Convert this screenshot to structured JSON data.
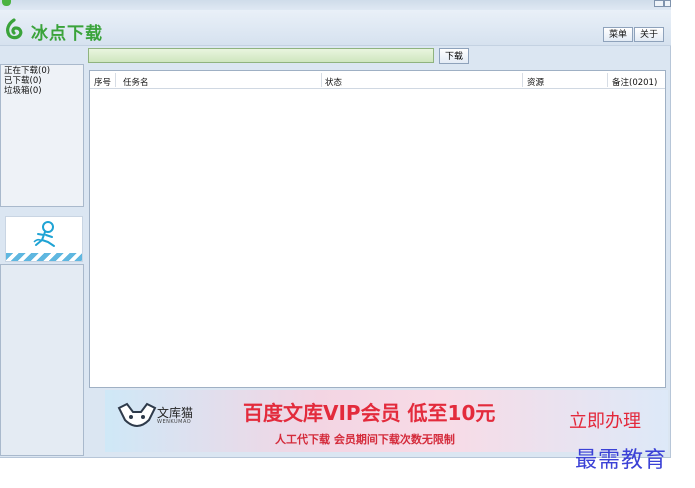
{
  "app": {
    "title": "冰点下载",
    "brand_color": "#3aa33a"
  },
  "header": {
    "menu_label": "菜单",
    "about_label": "关于"
  },
  "search": {
    "value": "",
    "download_label": "下载",
    "bar_color": "#d6ebc8"
  },
  "sidebar": {
    "categories": [
      {
        "label": "正在下载(0)"
      },
      {
        "label": "已下载(0)"
      },
      {
        "label": "垃圾箱(0)"
      }
    ],
    "promo_icon": "running-mascot-icon"
  },
  "table": {
    "columns": [
      "序号",
      "任务名",
      "状态",
      "资源",
      "备注(0201)"
    ],
    "rows": []
  },
  "banner": {
    "logo_text": "文库猫",
    "logo_sub": "WENKUMAO",
    "title": "百度文库VIP会员 低至10元",
    "subtitle": "人工代下载 会员期间下载次数无限制",
    "cta": "立即办理",
    "accent_color": "#e32b3c"
  },
  "watermark": "最需教育"
}
